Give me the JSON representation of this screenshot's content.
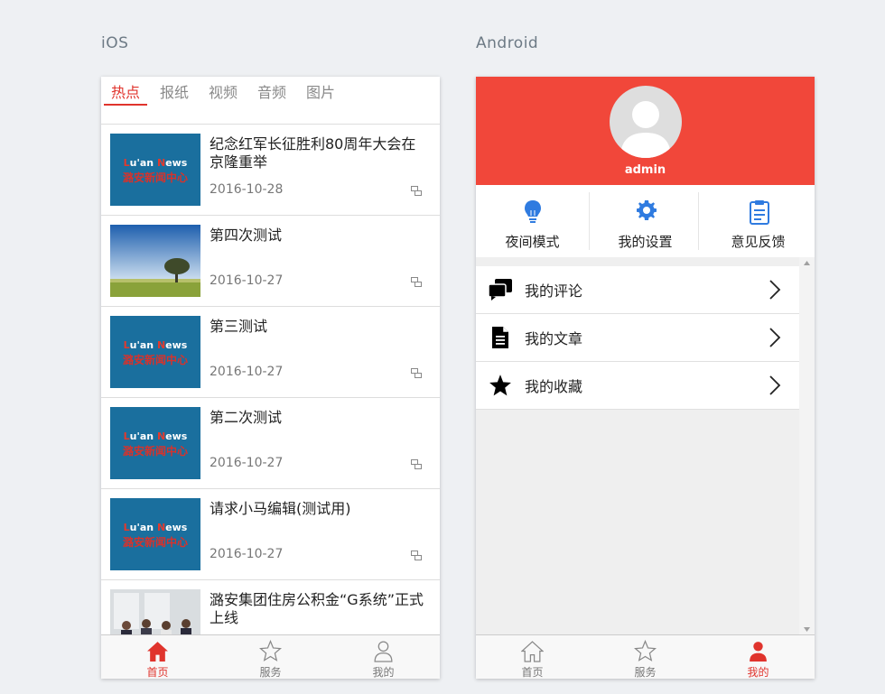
{
  "labels": {
    "ios": "iOS",
    "android": "Android"
  },
  "ios": {
    "tabs": [
      "热点",
      "报纸",
      "视频",
      "音频",
      "图片"
    ],
    "active_tab": 0,
    "logo_text": {
      "en_prefix": "L",
      "en_mid": "u'an ",
      "en_n": "N",
      "en_rest": "ews",
      "cn": "潞安新闻中心"
    },
    "news": [
      {
        "title": "纪念红军长征胜利80周年大会在京隆重举",
        "date": "2016-10-28",
        "thumb": "logo"
      },
      {
        "title": "第四次测试",
        "date": "2016-10-27",
        "thumb": "landscape"
      },
      {
        "title": "第三测试",
        "date": "2016-10-27",
        "thumb": "logo"
      },
      {
        "title": "第二次测试",
        "date": "2016-10-27",
        "thumb": "logo"
      },
      {
        "title": "请求小马编辑(测试用)",
        "date": "2016-10-27",
        "thumb": "logo"
      },
      {
        "title": "潞安集团住房公积金“G系统”正式上线",
        "date": "",
        "thumb": "photo"
      }
    ],
    "bottom_nav": [
      {
        "label": "首页",
        "icon": "home-icon",
        "active": true
      },
      {
        "label": "服务",
        "icon": "star-icon",
        "active": false
      },
      {
        "label": "我的",
        "icon": "person-icon",
        "active": false
      }
    ]
  },
  "android": {
    "username": "admin",
    "quick_actions": [
      {
        "label": "夜间模式",
        "icon": "bulb-icon"
      },
      {
        "label": "我的设置",
        "icon": "gear-icon"
      },
      {
        "label": "意见反馈",
        "icon": "clipboard-icon"
      }
    ],
    "menu": [
      {
        "label": "我的评论",
        "icon": "comments-icon"
      },
      {
        "label": "我的文章",
        "icon": "document-icon"
      },
      {
        "label": "我的收藏",
        "icon": "star-filled-icon"
      }
    ],
    "bottom_nav": [
      {
        "label": "首页",
        "icon": "home-icon",
        "active": false
      },
      {
        "label": "服务",
        "icon": "star-icon",
        "active": false
      },
      {
        "label": "我的",
        "icon": "person-icon",
        "active": true
      }
    ]
  },
  "colors": {
    "accent": "#e0342d",
    "header_red": "#f1473a",
    "icon_blue": "#2f7be0"
  }
}
